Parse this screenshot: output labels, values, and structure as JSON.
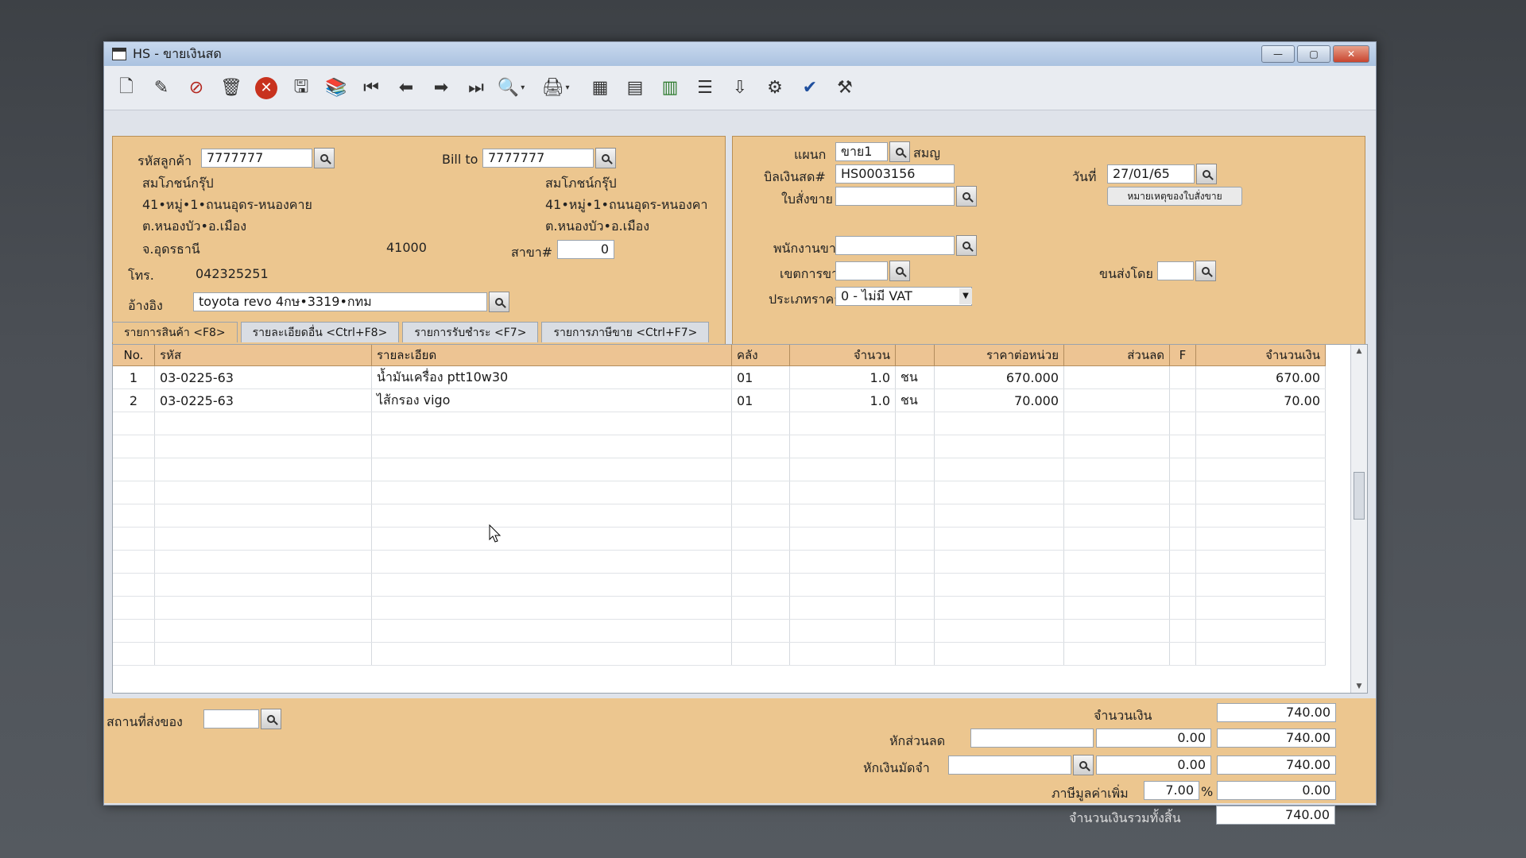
{
  "window": {
    "title": "HS - ขายเงินสด"
  },
  "toolbar_icons": [
    "new-icon",
    "edit-icon",
    "cancel-doc-icon",
    "delete-icon",
    "close-icon",
    "save-icon",
    "books-icon",
    "first-icon",
    "prev-icon",
    "next-icon",
    "last-icon",
    "search-doc-icon",
    "print-icon",
    "calc-icon",
    "form-icon",
    "report-icon",
    "list-icon",
    "import-icon",
    "tools-icon",
    "ok-icon",
    "settings-icon"
  ],
  "customer": {
    "code_label": "รหัสลูกค้า",
    "code": "7777777",
    "name": "สมโภชน์กรุ๊ป",
    "addr1": "41•หมู่•1•ถนนอุดร-หนองคาย",
    "addr2": "ต.หนองบัว•อ.เมือง",
    "province": "จ.อุดรธานี",
    "zip": "41000",
    "tel_label": "โทร.",
    "tel": "042325251",
    "ref_label": "อ้างอิง",
    "ref": "toyota revo 4กษ•3319•กทม"
  },
  "bill_to": {
    "label": "Bill to",
    "code": "7777777",
    "name": "สมโภชน์กรุ๊ป",
    "addr1": "41•หมู่•1•ถนนอุดร-หนองคา",
    "addr2": "ต.หนองบัว•อ.เมือง",
    "branch_label": "สาขา#",
    "branch": "0"
  },
  "doc": {
    "dept_label": "แผนก",
    "dept": "ขาย1",
    "dept_name": "สมญ",
    "bill_label": "บิลเงินสด#",
    "bill_no": "HS0003156",
    "date_label": "วันที่",
    "date": "27/01/65",
    "order_label": "ใบสั่งขาย",
    "order": "",
    "note_button": "หมายเหตุของใบสั่งขาย",
    "sales_label": "พนักงานขาย",
    "sales": "",
    "area_label": "เขตการขาย",
    "area": "",
    "ship_label": "ขนส่งโดย",
    "ship": "",
    "price_type_label": "ประเภทราคา",
    "price_type": "0 - ไม่มี VAT"
  },
  "tabs": [
    {
      "label": "รายการสินค้า <F8>"
    },
    {
      "label": "รายละเอียดอื่น <Ctrl+F8>"
    },
    {
      "label": "รายการรับชำระ <F7>"
    },
    {
      "label": "รายการภาษีขาย <Ctrl+F7>"
    }
  ],
  "grid": {
    "headers": {
      "no": "No.",
      "code": "รหัส",
      "desc": "รายละเอียด",
      "wh": "คลัง",
      "qty": "จำนวน",
      "unit": "",
      "price": "ราคาต่อหน่วย",
      "disc": "ส่วนลด",
      "f": "F",
      "amount": "จำนวนเงิน"
    },
    "rows": [
      {
        "no": "1",
        "code": "03-0225-63",
        "desc": "น้ำมันเครื่อง ptt10w30",
        "wh": "01",
        "qty": "1.0",
        "unit": "ชน",
        "price": "670.000",
        "disc": "",
        "f": "",
        "amount": "670.00"
      },
      {
        "no": "2",
        "code": "03-0225-63",
        "desc": "ไส้กรอง vigo",
        "wh": "01",
        "qty": "1.0",
        "unit": "ชน",
        "price": "70.000",
        "disc": "",
        "f": "",
        "amount": "70.00"
      }
    ]
  },
  "footer": {
    "ship_place_label": "สถานที่ส่งของ",
    "ship_place": "",
    "amount_label": "จำนวนเงิน",
    "amount": "740.00",
    "discount_label": "หักส่วนลด",
    "discount_text": "",
    "discount_value": "0.00",
    "after_discount": "740.00",
    "deposit_label": "หักเงินมัดจำ",
    "deposit_text": "",
    "deposit_value": "0.00",
    "after_deposit": "740.00",
    "vat_label": "ภาษีมูลค่าเพิ่ม",
    "vat_rate": "7.00",
    "vat_pct": "%",
    "vat_amount": "0.00",
    "total_label": "จำนวนเงินรวมทั้งสิ้น",
    "total": "740.00"
  }
}
